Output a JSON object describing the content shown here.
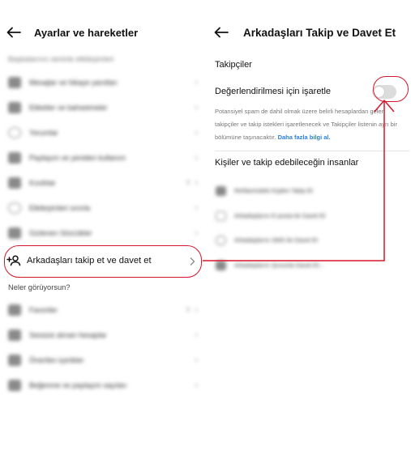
{
  "colors": {
    "accent_red": "#d6162a",
    "link_blue": "#2b7fd6",
    "toggle_off": "#dcdcdc"
  },
  "left": {
    "title": "Ayarlar ve hareketler",
    "blurred_section_header": "Başkalarının seninle etkileşimleri",
    "blurred_items": [
      {
        "label": "Mesajlar ve hikaye yanıtları",
        "icon": "message-icon",
        "meta": ""
      },
      {
        "label": "Etiketler ve bahsetmeler",
        "icon": "tag-icon",
        "meta": ""
      },
      {
        "label": "Yorumlar",
        "icon": "comment-icon",
        "meta": ""
      },
      {
        "label": "Paylaşım ve yeniden kullanım",
        "icon": "share-icon",
        "meta": ""
      },
      {
        "label": "Kısıtlılar",
        "icon": "restricted-icon",
        "meta": "0"
      },
      {
        "label": "Etkileşimleri sınırla",
        "icon": "limit-icon",
        "meta": ""
      },
      {
        "label": "Gizlenen Sözcükler",
        "icon": "hidden-words-icon",
        "meta": ""
      }
    ],
    "active_item": {
      "label": "Arkadaşları takip et ve davet et",
      "icon": "add-person-icon"
    },
    "section_header": "Neler görüyorsun?",
    "blurred_items_2": [
      {
        "label": "Favoriler",
        "icon": "star-icon",
        "meta": "0"
      },
      {
        "label": "Sessize alınan hesaplar",
        "icon": "mute-icon",
        "meta": ""
      },
      {
        "label": "Önerilen içerikler",
        "icon": "suggested-icon",
        "meta": ""
      },
      {
        "label": "Beğenme ve paylaşım sayıları",
        "icon": "likes-icon",
        "meta": ""
      }
    ]
  },
  "right": {
    "title": "Arkadaşları Takip ve Davet Et",
    "followers_header": "Takipçiler",
    "toggle_label": "Değerlendirilmesi için işaretle",
    "toggle_on": false,
    "description": "Potansiyel spam de dahil olmak üzere belirli hesaplardan gelen takipçiler ve takip istekleri işaretlenecek ve Takipçiler listenin ayrı bir bölümüne taşınacaktır.",
    "learn_more": "Daha fazla bilgi al.",
    "people_header": "Kişiler ve takip edebileceğin insanlar",
    "blurred_items": [
      {
        "label": "Rehberindeki Kişileri Takip Et",
        "icon": "contacts-icon"
      },
      {
        "label": "Arkadaşlarını E-posta ile Davet Et",
        "icon": "email-icon"
      },
      {
        "label": "Arkadaşlarını SMS ile Davet Et",
        "icon": "sms-icon"
      },
      {
        "label": "Arkadaşlarını Şununla Davet Et...",
        "icon": "share-icon"
      }
    ]
  }
}
